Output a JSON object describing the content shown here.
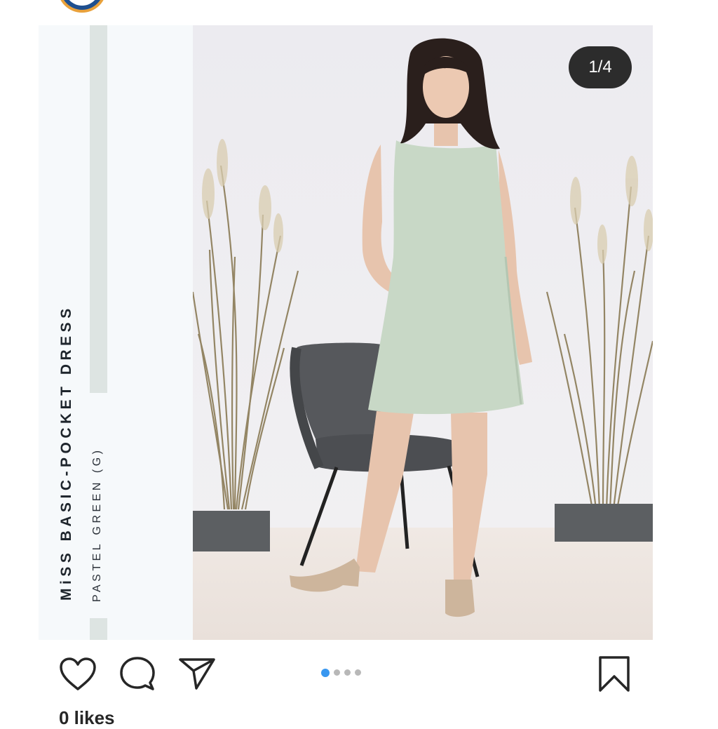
{
  "post": {
    "image_title": "MiSS BASIC-POCKET DRESS",
    "image_subtitle": "PASTEL GREEN (G)",
    "counter": "1/4",
    "carousel": {
      "total": 4,
      "active": 1
    },
    "likes": "0 likes"
  },
  "icons": {
    "like": "heart-icon",
    "comment": "comment-icon",
    "share": "send-icon",
    "save": "bookmark-icon"
  },
  "colors": {
    "dress": "#c8d8c6",
    "active_dot": "#3897f0",
    "side_bar": "#dde4e2"
  }
}
